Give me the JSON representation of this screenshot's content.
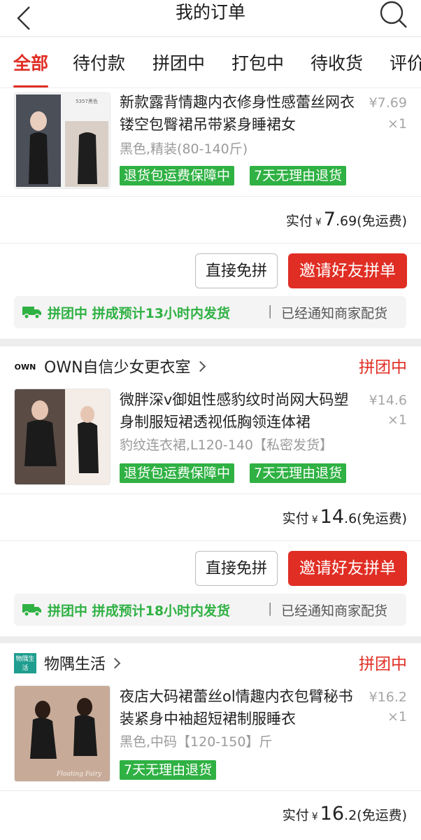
{
  "header": {
    "title": "我的订单",
    "back_icon": "chevron-left-icon",
    "search_icon": "search-icon"
  },
  "tabs": [
    {
      "label": "全部",
      "active": true
    },
    {
      "label": "待付款",
      "active": false
    },
    {
      "label": "拼团中",
      "active": false
    },
    {
      "label": "打包中",
      "active": false
    },
    {
      "label": "待收货",
      "active": false
    },
    {
      "label": "评价",
      "active": false
    }
  ],
  "orders": [
    {
      "shop": null,
      "product": {
        "title": "新款露背情趣内衣修身性感蕾丝网衣镂空包臀裙吊带紧身睡裙女",
        "spec": "黑色,精装(80-140斤)",
        "price": "¥7.69",
        "qty": "×1",
        "image_label": "5357黑色"
      },
      "tags": [
        "退货包运费保障中",
        "7天无理由退货"
      ],
      "paid": {
        "label": "实付",
        "yen": "¥",
        "int": "7",
        "dec": ".69",
        "note": "(免运费)"
      },
      "buttons": {
        "direct": "直接免拼",
        "invite": "邀请好友拼单"
      },
      "notice": {
        "green": "拼团中 拼成预计13小时内发货",
        "sep": "|",
        "gray": "已经通知商家配货"
      }
    },
    {
      "shop": {
        "logo_text": "OWN",
        "name": "OWN自信少女更衣室",
        "status": "拼团中"
      },
      "product": {
        "title": "微胖深v御姐性感豹纹时尚网大码塑身制服短裙透视低胸领连体裙",
        "spec": "豹纹连衣裙,L120-140【私密发货】",
        "price": "¥14.6",
        "qty": "×1"
      },
      "tags": [
        "退货包运费保障中",
        "7天无理由退货"
      ],
      "paid": {
        "label": "实付",
        "yen": "¥",
        "int": "14",
        "dec": ".6",
        "note": "(免运费)"
      },
      "buttons": {
        "direct": "直接免拼",
        "invite": "邀请好友拼单"
      },
      "notice": {
        "green": "拼团中 拼成预计18小时内发货",
        "sep": "|",
        "gray": "已经通知商家配货"
      }
    },
    {
      "shop": {
        "logo_text": "物隅生活",
        "name": "物隅生活",
        "status": "拼团中"
      },
      "product": {
        "title": "夜店大码裙蕾丝ol情趣内衣包臂秘书装紧身中袖超短裙制服睡衣",
        "spec": "黑色,中码【120-150】斤",
        "price": "¥16.2",
        "qty": "×1",
        "image_label": "Floating Fairy"
      },
      "tags": [
        "7天无理由退货"
      ],
      "paid": {
        "label": "实付",
        "yen": "¥",
        "int": "16",
        "dec": ".2",
        "note": "(免运费)"
      }
    }
  ],
  "colors": {
    "accent_red": "#e02e24",
    "tag_green": "#2fb143",
    "bg_gray": "#ededed"
  }
}
